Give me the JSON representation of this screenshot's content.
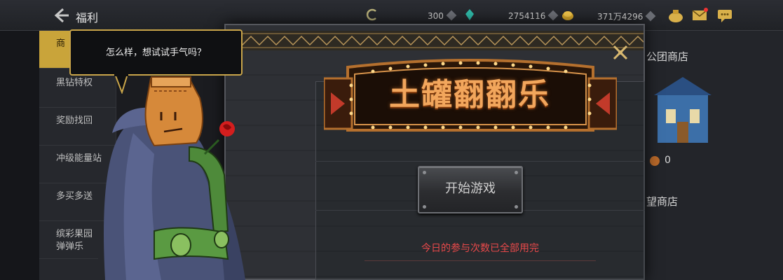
{
  "header": {
    "title": "福利",
    "resources": [
      {
        "icon": "vitality-icon",
        "value": ""
      },
      {
        "icon": "crystal-icon",
        "value": "300"
      },
      {
        "icon": "gold-icon",
        "value": "2754116"
      },
      {
        "icon": "coin-icon",
        "value": "371万4296"
      }
    ]
  },
  "sidebar": {
    "items": [
      {
        "label": "商"
      },
      {
        "label": "黑钻特权"
      },
      {
        "label": "奖励找回"
      },
      {
        "label": "冲级能量站"
      },
      {
        "label": "多买多送"
      },
      {
        "label": "缤彩果园弹弹乐"
      }
    ]
  },
  "right_panel": {
    "shop1": "公团商店",
    "count": "0",
    "shop2": "望商店"
  },
  "dialog": {
    "speech": "怎么样，想试试手气吗？",
    "game_title": "土罐翻翻乐",
    "start_button": "开始游戏",
    "status": "今日的参与次数已全部用完"
  },
  "colors": {
    "accent_gold": "#c9a43a",
    "status_red": "#e8494a",
    "title_orange": "#f2a65c"
  }
}
